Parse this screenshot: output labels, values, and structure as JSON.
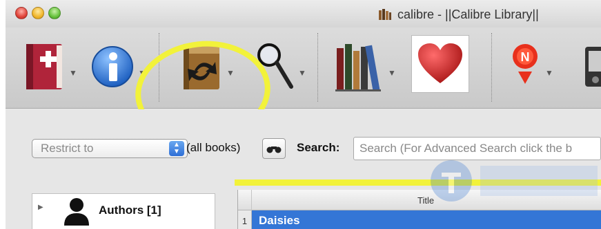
{
  "window": {
    "title": "calibre - ||Calibre Library||"
  },
  "toolbar": {
    "items": [
      {
        "name": "add-books",
        "icon": "red-book-plus-icon"
      },
      {
        "name": "edit-metadata",
        "icon": "info-icon"
      },
      {
        "name": "convert-books",
        "icon": "convert-book-icon"
      },
      {
        "name": "view",
        "icon": "magnifier-icon"
      },
      {
        "name": "library",
        "icon": "library-books-icon"
      },
      {
        "name": "donate",
        "icon": "heart-icon"
      },
      {
        "name": "fetch-news",
        "icon": "news-icon"
      },
      {
        "name": "device",
        "icon": "device-icon"
      }
    ],
    "highlight_color": "#f2f23a"
  },
  "search_bar": {
    "restrict_label": "Restrict to",
    "all_books": "(all books)",
    "search_label": "Search:",
    "search_placeholder": "Search (For Advanced Search click the b"
  },
  "tag_browser": {
    "items": [
      {
        "label": "Authors [1]",
        "icon": "person-icon"
      }
    ]
  },
  "book_list": {
    "columns": [
      "Title"
    ],
    "rows": [
      {
        "num": "1",
        "title": "Daisies"
      }
    ],
    "selection_color": "#3476d6"
  }
}
